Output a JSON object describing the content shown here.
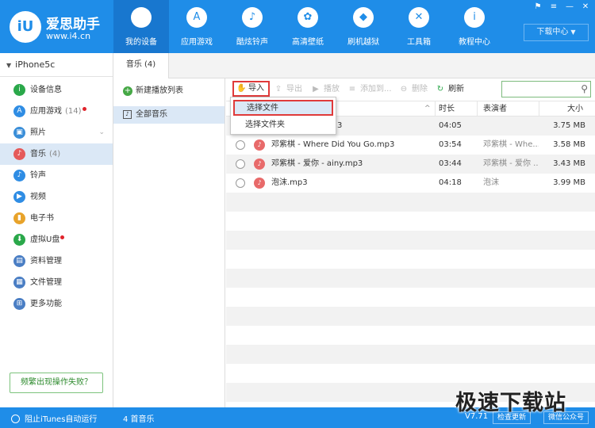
{
  "header": {
    "logo_mark": "iU",
    "logo_name": "爱思助手",
    "logo_url": "www.i4.cn",
    "nav": [
      {
        "label": "我的设备",
        "icon": "apple-icon",
        "glyph": "",
        "active": true
      },
      {
        "label": "应用游戏",
        "icon": "app-store-icon",
        "glyph": "A",
        "active": false
      },
      {
        "label": "酷炫铃声",
        "icon": "bell-icon",
        "glyph": "♪",
        "active": false
      },
      {
        "label": "高清壁纸",
        "icon": "flower-icon",
        "glyph": "✿",
        "active": false
      },
      {
        "label": "刷机越狱",
        "icon": "dropbox-icon",
        "glyph": "◆",
        "active": false
      },
      {
        "label": "工具箱",
        "icon": "tools-icon",
        "glyph": "✕",
        "active": false
      },
      {
        "label": "教程中心",
        "icon": "info-icon",
        "glyph": "i",
        "active": false
      }
    ],
    "download_center": "下载中心",
    "window_controls": [
      "⚑",
      "≡",
      "—",
      "✕"
    ]
  },
  "sidebar": {
    "device_name": "iPhone5c",
    "items": [
      {
        "label": "设备信息",
        "icon": "info-icon",
        "color": "#2aa84a",
        "glyph": "i",
        "count": "",
        "dot": false,
        "chevron": false,
        "active": false
      },
      {
        "label": "应用游戏",
        "icon": "app-icon",
        "color": "#2f8de4",
        "glyph": "A",
        "count": "(14)",
        "dot": true,
        "chevron": false,
        "active": false
      },
      {
        "label": "照片",
        "icon": "photo-icon",
        "color": "#3a8ed8",
        "glyph": "▣",
        "count": "",
        "dot": false,
        "chevron": true,
        "active": false
      },
      {
        "label": "音乐",
        "icon": "music-icon",
        "color": "#e55a5a",
        "glyph": "♪",
        "count": "(4)",
        "dot": false,
        "chevron": false,
        "active": true
      },
      {
        "label": "铃声",
        "icon": "bell-icon",
        "color": "#2f8de4",
        "glyph": "♪",
        "count": "",
        "dot": false,
        "chevron": false,
        "active": false
      },
      {
        "label": "视频",
        "icon": "video-icon",
        "color": "#2f8de4",
        "glyph": "▶",
        "count": "",
        "dot": false,
        "chevron": false,
        "active": false
      },
      {
        "label": "电子书",
        "icon": "book-icon",
        "color": "#e8a32a",
        "glyph": "▮",
        "count": "",
        "dot": false,
        "chevron": false,
        "active": false
      },
      {
        "label": "虚拟U盘",
        "icon": "usb-icon",
        "color": "#2aa84a",
        "glyph": "⬇",
        "count": "",
        "dot": true,
        "chevron": false,
        "active": false
      },
      {
        "label": "资料管理",
        "icon": "contacts-icon",
        "color": "#4a7ec4",
        "glyph": "▤",
        "count": "",
        "dot": false,
        "chevron": false,
        "active": false
      },
      {
        "label": "文件管理",
        "icon": "file-icon",
        "color": "#4a7ec4",
        "glyph": "▦",
        "count": "",
        "dot": false,
        "chevron": false,
        "active": false
      },
      {
        "label": "更多功能",
        "icon": "grid-icon",
        "color": "#4a7ec4",
        "glyph": "⊞",
        "count": "",
        "dot": false,
        "chevron": false,
        "active": false
      }
    ],
    "help_button": "频繁出现操作失败？"
  },
  "tabs": {
    "music_tab": "音乐 (4)"
  },
  "playlist": {
    "new_playlist": "新建播放列表",
    "all_music": "全部音乐"
  },
  "toolbar": {
    "import": "导入",
    "export": "导出",
    "play": "播放",
    "add_to": "添加到...",
    "delete": "删除",
    "refresh": "刷新",
    "search_placeholder": ""
  },
  "dropdown": {
    "choose_file": "选择文件",
    "choose_folder": "选择文件夹"
  },
  "table": {
    "headers": {
      "duration": "时长",
      "artist": "表演者",
      "size": "大小"
    },
    "rows": [
      {
        "name": "",
        "duration": "04:05",
        "artist": "",
        "size": "3.75 MB"
      },
      {
        "name": "邓紫棋 - Where Did You Go.mp3",
        "duration": "03:54",
        "artist": "邓紫棋 - Whe...",
        "size": "3.58 MB"
      },
      {
        "name": "邓紫棋 - 爱你 - ainy.mp3",
        "duration": "03:44",
        "artist": "邓紫棋 - 爱你 ...",
        "size": "3.43 MB"
      },
      {
        "name": "泡沫.mp3",
        "duration": "04:18",
        "artist": "泡沫",
        "size": "3.99 MB"
      }
    ],
    "partial_name_tail": "3"
  },
  "statusbar": {
    "itunes": "阻止iTunes自动运行",
    "song_count": "4 首音乐",
    "version": "V7.71",
    "check_update": "检查更新",
    "wechat": "微信公众号"
  },
  "watermark": {
    "text": "极速下载站"
  }
}
